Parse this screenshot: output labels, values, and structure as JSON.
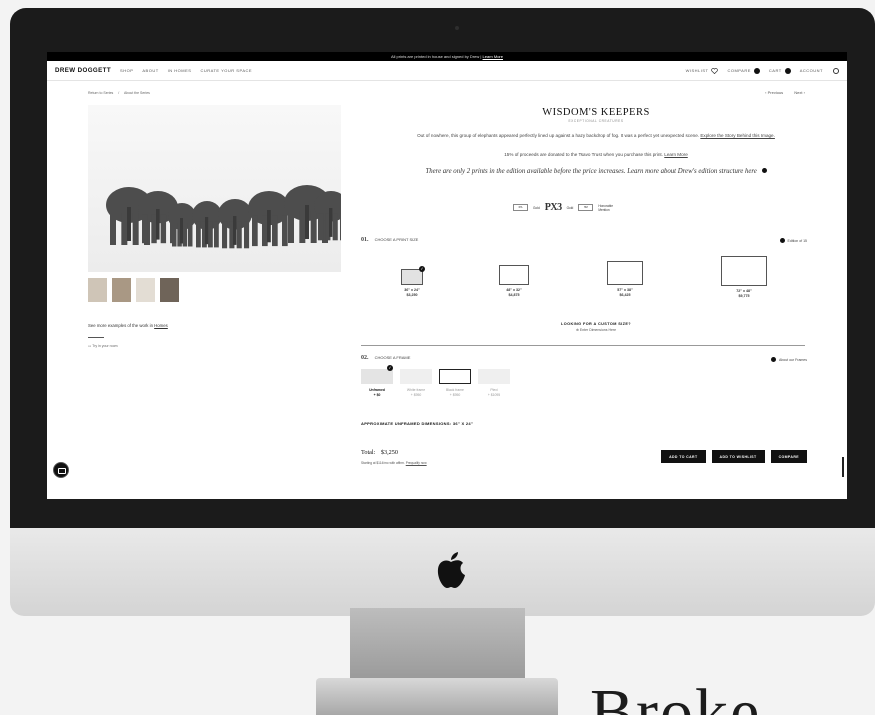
{
  "announcement": {
    "text": "All prints are printed in house and signed by Drew |",
    "link": "Learn More"
  },
  "nav": {
    "logo": "DREW DOGGETT",
    "items": [
      "SHOP",
      "ABOUT",
      "IN HOMES",
      "CURATE YOUR SPACE"
    ],
    "wishlist": "WISHLIST",
    "compare": "COMPARE",
    "cart": "CART",
    "account": "ACCOUNT"
  },
  "breadcrumb": {
    "back": "Return to Series",
    "sep": "/",
    "current": "About the Series"
  },
  "pager": {
    "previous": "Previous",
    "next": "Next"
  },
  "product": {
    "title": "WISDOM'S KEEPERS",
    "subtitle": "EXCEPTIONAL CREATURES",
    "description": "Out of nowhere, this group of elephants appeared perfectly lined up against a hazy backdrop of fog. It was a perfect yet unexpected scene.",
    "story_link": "Explore the Story Behind this Image.",
    "donation": "15% of proceeds are donated to the Tsavo Trust when you purchase this print.",
    "donation_link": "Learn More",
    "edition_note": "There are only 2 prints in the edition available before the price increases. Learn more about Drew's edition structure here"
  },
  "awards": [
    {
      "logo": "IPA",
      "label": "Gold"
    },
    {
      "logo": "PX3",
      "label": "Gold"
    },
    {
      "logo": "HM",
      "label": "Honorable Mention"
    }
  ],
  "size_section": {
    "number": "01.",
    "title": "CHOOSE A PRINT SIZE",
    "note": "Edition of 15",
    "sizes": [
      {
        "dims": "36\" x 24\"",
        "price": "$3,250",
        "selected": true
      },
      {
        "dims": "48\" x 32\"",
        "price": "$4,875",
        "selected": false
      },
      {
        "dims": "57\" x 38\"",
        "price": "$6,425",
        "selected": false
      },
      {
        "dims": "72\" x 48\"",
        "price": "$9,775",
        "selected": false
      }
    ],
    "custom_title": "LOOKING FOR A CUSTOM SIZE?",
    "custom_link": "Enter Dimensions Here"
  },
  "frame_section": {
    "number": "02.",
    "title": "CHOOSE A FRAME",
    "note": "About our Frames",
    "frames": [
      {
        "name": "Unframed",
        "price": "+ $0"
      },
      {
        "name": "White frame",
        "price": "+ $950"
      },
      {
        "name": "Black frame",
        "price": "+ $950"
      },
      {
        "name": "Plexi",
        "price": "+ $1095"
      }
    ]
  },
  "approx_dims": "APPROXIMATE UNFRAMED DIMENSIONS: 36\" X 24\"",
  "checkout": {
    "total_label": "Total:",
    "total_value": "$3,250",
    "financing": "Starting at $114/mo with affirm.",
    "financing_link": "Prequalify now",
    "buttons": [
      "ADD TO CART",
      "ADD TO WISHLIST",
      "COMPARE"
    ]
  },
  "left_links": {
    "see_more": "See more examples of the work in",
    "homes_link": "Homes",
    "try_room": "Try in your room"
  },
  "background_word": "Broke",
  "elephant_fill": "#4d4d4d"
}
